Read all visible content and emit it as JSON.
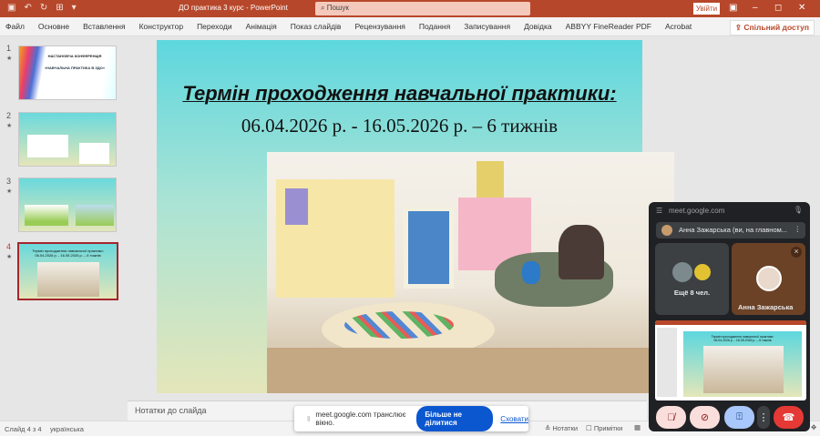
{
  "titlebar": {
    "title": "ДО практика 3 курс  -  PowerPoint",
    "search_placeholder": "Пошук",
    "login": "Увійти"
  },
  "ribbon": {
    "tabs": [
      "Файл",
      "Основне",
      "Вставлення",
      "Конструктор",
      "Переходи",
      "Анімація",
      "Показ слайдів",
      "Рецензування",
      "Подання",
      "Записування",
      "Довідка",
      "ABBYY FineReader PDF",
      "Acrobat"
    ],
    "share": "Спільний доступ"
  },
  "thumbnails": [
    {
      "num": "1",
      "line1": "НАСТАНОВЧА КОНФЕРЕНЦІЯ",
      "line2": "«НАВЧАЛЬНА ПРАКТИКА В ЗДО»"
    },
    {
      "num": "2"
    },
    {
      "num": "3"
    },
    {
      "num": "4",
      "title": "Термін проходження навчальної практики:",
      "date": "06.04.2026 р. - 16.05.2026 р. – 6 тижнів"
    }
  ],
  "slide": {
    "title": "Термін проходження навчальної практики:",
    "dates": "06.04.2026 р. - 16.05.2026 р. – 6 тижнів"
  },
  "notes": {
    "placeholder": "Нотатки до слайда"
  },
  "sharebar": {
    "text": "meet.google.com транслює вікно.",
    "stop": "Більше не ділитися",
    "hide": "Сховати"
  },
  "status": {
    "slide": "Слайд 4 з 4",
    "language": "українська",
    "notes": "Нотатки",
    "comments": "Примітки"
  },
  "meet": {
    "url": "meet.google.com",
    "self": "Анна Зажарська (ви, на главном...",
    "others": "Ещё 8 чел.",
    "speaker": "Анна Зажарська"
  },
  "colors": {
    "accent": "#b7472a",
    "meet_bg": "#202124",
    "end_call": "#e53935",
    "share_blue": "#0b57d0"
  }
}
